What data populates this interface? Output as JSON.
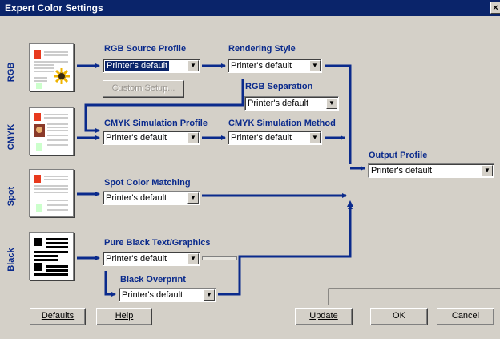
{
  "window": {
    "title": "Expert Color Settings",
    "close_glyph": "×"
  },
  "rows": {
    "rgb": "RGB",
    "cmyk": "CMYK",
    "spot": "Spot",
    "black": "Black"
  },
  "sections": {
    "rgb_source_profile": {
      "label": "RGB Source Profile",
      "value": "Printer's default"
    },
    "custom_setup": "Custom Setup...",
    "rendering_style": {
      "label": "Rendering Style",
      "value": "Printer's default"
    },
    "rgb_separation": {
      "label": "RGB Separation",
      "value": "Printer's default"
    },
    "cmyk_simulation_profile": {
      "label": "CMYK Simulation Profile",
      "value": "Printer's default"
    },
    "cmyk_simulation_method": {
      "label": "CMYK Simulation Method",
      "value": "Printer's default"
    },
    "output_profile": {
      "label": "Output Profile",
      "value": "Printer's default"
    },
    "spot_color_matching": {
      "label": "Spot Color Matching",
      "value": "Printer's default"
    },
    "pure_black": {
      "label": "Pure Black Text/Graphics",
      "value": "Printer's default"
    },
    "black_overprint": {
      "label": "Black Overprint",
      "value": "Printer's default"
    }
  },
  "buttons": {
    "defaults": {
      "label": "Defaults"
    },
    "help": {
      "label": "Help"
    },
    "update": {
      "label": "Update"
    },
    "ok": {
      "label": "OK"
    },
    "cancel": {
      "label": "Cancel"
    }
  },
  "colors": {
    "accent": "#0a2a8c",
    "titlebar": "#0a246a",
    "face": "#d4d0c8"
  }
}
